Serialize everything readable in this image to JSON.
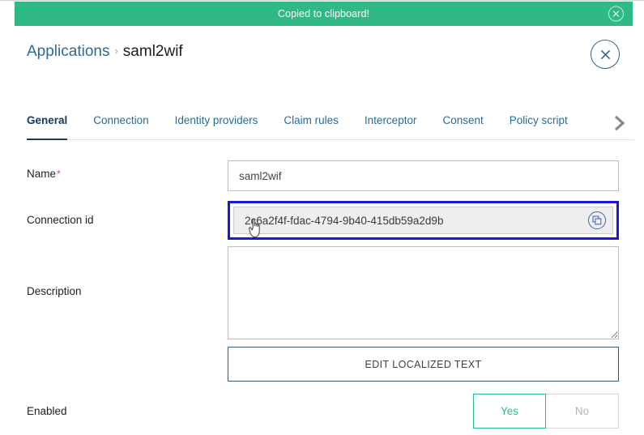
{
  "toast": {
    "message": "Copied to clipboard!",
    "close_icon": "close-circle-icon",
    "background_color": "#2fb987",
    "text_color": "#ffffff"
  },
  "header": {
    "breadcrumb": {
      "parent": "Applications",
      "separator": "›",
      "current": "saml2wif"
    },
    "close_icon": "close-icon",
    "accent_color": "#33658d"
  },
  "tabs": {
    "items": [
      {
        "label": "General",
        "active": true
      },
      {
        "label": "Connection",
        "active": false
      },
      {
        "label": "Identity providers",
        "active": false
      },
      {
        "label": "Claim rules",
        "active": false
      },
      {
        "label": "Interceptor",
        "active": false
      },
      {
        "label": "Consent",
        "active": false
      },
      {
        "label": "Policy script",
        "active": false
      }
    ],
    "next_icon": "chevron-right-icon",
    "active_color": "#123a5c",
    "inactive_color": "#2a6a96"
  },
  "form": {
    "name": {
      "label": "Name",
      "required_marker": "*",
      "value": "saml2wif",
      "placeholder": ""
    },
    "connection_id": {
      "label": "Connection id",
      "value": "2c6a2f4f-fdac-4794-9b40-415db59a2d9b",
      "copy_icon": "copy-icon",
      "focused": true,
      "focus_ring_color": "#1a18e0"
    },
    "description": {
      "label": "Description",
      "value": "",
      "placeholder": ""
    },
    "localized_text_button": {
      "label": "EDIT LOCALIZED TEXT"
    },
    "enabled": {
      "label": "Enabled",
      "options": [
        {
          "label": "Yes",
          "selected": true
        },
        {
          "label": "No",
          "selected": false
        }
      ],
      "selected_color": "#27bd82"
    }
  },
  "cursor": {
    "icon": "hand-pointer-cursor"
  }
}
